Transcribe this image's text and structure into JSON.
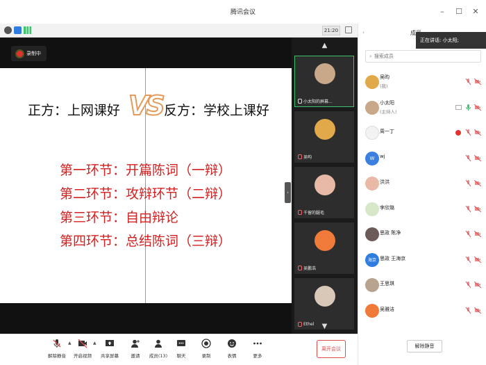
{
  "window": {
    "title": "腾讯会议"
  },
  "statusbar": {
    "time": "21:20"
  },
  "recording": {
    "label": "录制中"
  },
  "slide": {
    "pro": "正方：上网课好",
    "vs": "VS",
    "con": "反方：学校上课好",
    "stages": [
      "第一环节：开篇陈词（一辩）",
      "第二环节：攻辩环节（二辩）",
      "第三环节：自由辩论",
      "第四环节：总结陈词（三辩）"
    ]
  },
  "video_strip": {
    "tiles": [
      {
        "label": "小太阳的屏幕...",
        "avatar_color": "#c9a88a",
        "active": true
      },
      {
        "label": "吴昀",
        "avatar_color": "#e2a94a",
        "active": false
      },
      {
        "label": "千留的腿毛",
        "avatar_color": "#e7b9a6",
        "active": false
      },
      {
        "label": "吴鹏浩",
        "avatar_color": "#f07a3a",
        "active": false
      },
      {
        "label": "Ethel",
        "avatar_color": "#d9c7b8",
        "active": false
      }
    ]
  },
  "toolbar": {
    "unmute": "解除静音",
    "video": "开启视频",
    "share": "共享屏幕",
    "invite": "邀请",
    "members": "成员(13)",
    "chat": "聊天",
    "record": "录制",
    "emoji": "表情",
    "more": "更多",
    "leave": "离开会议"
  },
  "panel": {
    "tab": "成员",
    "speaking": "正在讲话: 小太阳;",
    "search_placeholder": "搜索成员",
    "unmute_all": "解除静音",
    "participants": [
      {
        "name": "吴昀",
        "role": "(我)",
        "avatar_color": "#e2a94a",
        "avatar_text": ""
      },
      {
        "name": "小太阳",
        "role": "(主持人)",
        "avatar_color": "#c9a88a",
        "avatar_text": ""
      },
      {
        "name": "周一丁",
        "role": "",
        "avatar_color": "#f3f3f3",
        "avatar_text": ""
      },
      {
        "name": "wj",
        "role": "",
        "avatar_color": "#3b7fe0",
        "avatar_text": "W"
      },
      {
        "name": "洪洪",
        "role": "",
        "avatar_color": "#e7b9a6",
        "avatar_text": ""
      },
      {
        "name": "李欣璐",
        "role": "",
        "avatar_color": "#d6e8c8",
        "avatar_text": ""
      },
      {
        "name": "思政 陈净",
        "role": "",
        "avatar_color": "#6b5a55",
        "avatar_text": ""
      },
      {
        "name": "思政 王海京",
        "role": "",
        "avatar_color": "#2f7de0",
        "avatar_text": "海京"
      },
      {
        "name": "王思琪",
        "role": "",
        "avatar_color": "#b7a38e",
        "avatar_text": ""
      },
      {
        "name": "吴雅洁",
        "role": "",
        "avatar_color": "#f07a3a",
        "avatar_text": ""
      }
    ]
  }
}
